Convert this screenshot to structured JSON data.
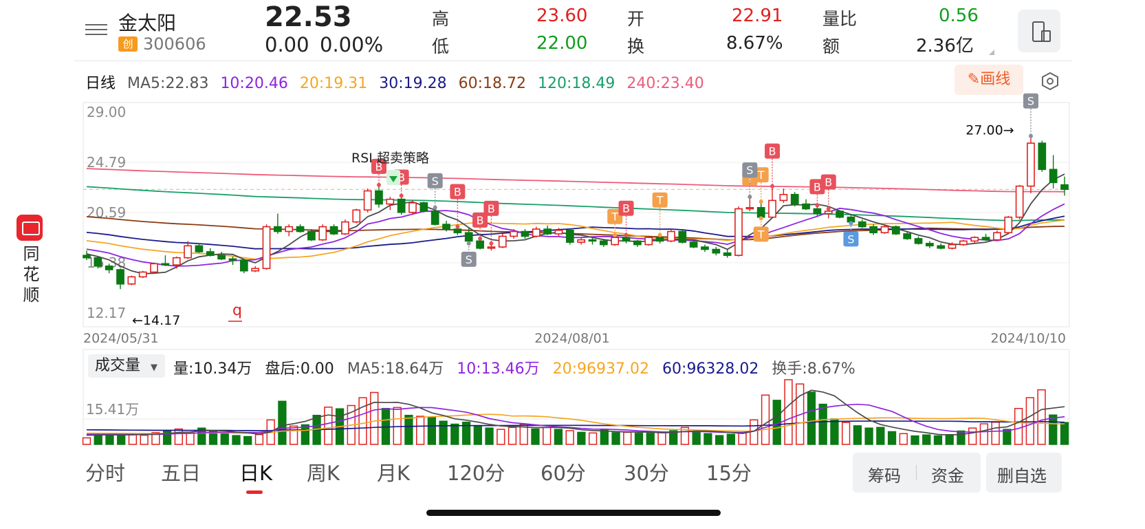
{
  "brand": {
    "name": "同花顺"
  },
  "stock": {
    "name": "金太阳",
    "board_badge": "创",
    "code": "300606",
    "price": "22.53",
    "change": "0.00",
    "change_pct": "0.00%"
  },
  "quote": {
    "high_label": "高",
    "high_value": "23.60",
    "low_label": "低",
    "low_value": "22.00",
    "open_label": "开",
    "open_value": "22.91",
    "turnover_label": "换",
    "turnover_value": "8.67%",
    "vol_ratio_label": "量比",
    "vol_ratio_value": "0.56",
    "amount_label": "额",
    "amount_value": "2.36亿"
  },
  "ma_legend": {
    "period": "日线",
    "ma5": "MA5:22.83",
    "ma10": "10:20.46",
    "ma20": "20:19.31",
    "ma30": "30:19.28",
    "ma60": "60:18.72",
    "ma120": "120:18.49",
    "ma240": "240:23.40"
  },
  "draw_button": "画线",
  "colors": {
    "up": "#e0201e",
    "down": "#0b7a14",
    "ma5": "#4a4a4a",
    "ma10": "#8e24e0",
    "ma20": "#f5a623",
    "ma30": "#1a1a8c",
    "ma60": "#8b3a12",
    "ma120": "#16a068",
    "ma240": "#ec5c7a"
  },
  "kline_axis": {
    "y_labels": [
      "29.00",
      "24.79",
      "20.59",
      "16.38",
      "12.17"
    ],
    "x_labels": [
      "2024/05/31",
      "2024/08/01",
      "2024/10/10"
    ],
    "max_marker": "27.00→",
    "min_marker": "←14.17",
    "strategy_label": "RSI 超卖策略",
    "q_marker": "q"
  },
  "signals": [
    {
      "t": "B"
    },
    {
      "t": "S"
    },
    {
      "t": "B"
    },
    {
      "t": "B"
    },
    {
      "t": "S"
    },
    {
      "t": "B"
    },
    {
      "t": "T"
    },
    {
      "t": "B"
    },
    {
      "t": "T"
    },
    {
      "t": "T"
    },
    {
      "t": "T"
    },
    {
      "t": "B"
    },
    {
      "t": "B"
    },
    {
      "t": "B"
    },
    {
      "t": "S"
    },
    {
      "t": "T"
    },
    {
      "t": "S"
    },
    {
      "t": "S"
    },
    {
      "t": "B"
    }
  ],
  "volume": {
    "selector": "成交量",
    "vol": "量:10.34万",
    "after_hours": "盘后:0.00",
    "ma5": "MA5:18.64万",
    "ma10": "10:13.46万",
    "ma20": "20:96937.02",
    "ma60": "60:96328.02",
    "turnover": "换手:8.67%",
    "y_label": "15.41万"
  },
  "chart_data": [
    {
      "type": "candlestick",
      "title": "日线",
      "x_start": "2024/05/31",
      "x_mid": "2024/08/01",
      "x_end": "2024/10/10",
      "ylim": [
        12.17,
        29.0
      ],
      "candles_ohlc": [
        [
          17.0,
          17.4,
          16.6,
          16.8
        ],
        [
          16.8,
          16.9,
          15.9,
          16.1
        ],
        [
          16.1,
          16.3,
          15.5,
          15.8
        ],
        [
          15.8,
          15.9,
          14.17,
          14.6
        ],
        [
          14.6,
          15.3,
          14.5,
          15.2
        ],
        [
          15.2,
          15.7,
          15.1,
          15.6
        ],
        [
          15.6,
          16.4,
          15.5,
          16.3
        ],
        [
          16.3,
          17.0,
          16.1,
          16.2
        ],
        [
          16.2,
          16.9,
          15.9,
          16.8
        ],
        [
          16.8,
          18.2,
          16.7,
          17.8
        ],
        [
          17.8,
          18.0,
          17.2,
          17.3
        ],
        [
          17.3,
          17.6,
          16.9,
          17.0
        ],
        [
          17.0,
          17.3,
          16.6,
          16.7
        ],
        [
          16.7,
          16.9,
          16.2,
          16.6
        ],
        [
          16.6,
          16.7,
          15.5,
          15.7
        ],
        [
          15.7,
          16.1,
          15.6,
          15.9
        ],
        [
          15.9,
          19.6,
          15.8,
          19.4
        ],
        [
          19.4,
          20.5,
          18.8,
          19.0
        ],
        [
          19.0,
          19.6,
          18.6,
          19.4
        ],
        [
          19.4,
          19.6,
          18.9,
          19.0
        ],
        [
          19.0,
          19.2,
          18.2,
          18.3
        ],
        [
          18.3,
          19.6,
          18.2,
          19.4
        ],
        [
          19.4,
          19.6,
          18.7,
          18.8
        ],
        [
          18.8,
          20.0,
          18.7,
          19.8
        ],
        [
          19.8,
          20.9,
          19.7,
          20.8
        ],
        [
          20.8,
          22.6,
          20.6,
          22.4
        ],
        [
          22.4,
          22.9,
          21.0,
          21.3
        ],
        [
          21.3,
          21.9,
          20.8,
          21.7
        ],
        [
          21.7,
          22.0,
          20.4,
          20.6
        ],
        [
          20.6,
          21.6,
          20.4,
          21.4
        ],
        [
          21.4,
          21.5,
          20.6,
          20.7
        ],
        [
          20.7,
          21.0,
          19.5,
          19.6
        ],
        [
          19.6,
          19.9,
          19.0,
          19.2
        ],
        [
          19.2,
          19.4,
          18.7,
          18.9
        ],
        [
          18.9,
          19.3,
          18.0,
          18.2
        ],
        [
          18.2,
          18.4,
          17.5,
          17.6
        ],
        [
          17.6,
          18.0,
          17.4,
          17.7
        ],
        [
          17.7,
          18.8,
          17.6,
          18.6
        ],
        [
          18.6,
          19.2,
          18.4,
          19.0
        ],
        [
          19.0,
          19.2,
          18.4,
          18.6
        ],
        [
          18.6,
          19.4,
          18.5,
          19.2
        ],
        [
          19.2,
          19.5,
          18.7,
          18.8
        ],
        [
          18.8,
          19.3,
          18.6,
          19.1
        ],
        [
          19.1,
          19.2,
          17.9,
          18.1
        ],
        [
          18.1,
          18.5,
          17.9,
          18.3
        ],
        [
          18.3,
          18.5,
          17.9,
          18.2
        ],
        [
          18.2,
          18.3,
          17.7,
          17.9
        ],
        [
          17.9,
          18.7,
          17.8,
          18.5
        ],
        [
          18.5,
          18.7,
          18.0,
          18.2
        ],
        [
          18.2,
          18.3,
          17.7,
          17.9
        ],
        [
          17.9,
          18.6,
          17.8,
          18.5
        ],
        [
          18.5,
          18.7,
          18.0,
          18.2
        ],
        [
          18.2,
          19.2,
          18.1,
          19.0
        ],
        [
          19.0,
          19.1,
          18.0,
          18.1
        ],
        [
          18.1,
          18.3,
          17.6,
          17.7
        ],
        [
          17.7,
          17.9,
          17.3,
          17.5
        ],
        [
          17.5,
          17.7,
          17.0,
          17.2
        ],
        [
          17.2,
          17.5,
          16.8,
          17.0
        ],
        [
          17.0,
          21.1,
          16.9,
          20.9
        ],
        [
          20.9,
          21.9,
          20.7,
          21.0
        ],
        [
          21.0,
          21.5,
          20.1,
          20.2
        ],
        [
          20.2,
          22.8,
          20.1,
          21.6
        ],
        [
          21.6,
          22.6,
          21.4,
          22.1
        ],
        [
          22.1,
          22.3,
          21.1,
          21.3
        ],
        [
          21.3,
          21.7,
          20.8,
          20.9
        ],
        [
          20.9,
          21.2,
          20.3,
          20.5
        ],
        [
          20.5,
          20.9,
          20.1,
          20.7
        ],
        [
          20.7,
          20.8,
          20.1,
          20.2
        ],
        [
          20.2,
          20.4,
          19.7,
          19.8
        ],
        [
          19.8,
          20.0,
          19.3,
          19.4
        ],
        [
          19.4,
          19.6,
          18.7,
          18.9
        ],
        [
          18.9,
          19.5,
          18.8,
          19.4
        ],
        [
          19.4,
          19.5,
          18.7,
          18.8
        ],
        [
          18.8,
          19.0,
          18.3,
          18.4
        ],
        [
          18.4,
          18.6,
          17.9,
          18.0
        ],
        [
          18.0,
          18.2,
          17.6,
          17.8
        ],
        [
          17.8,
          18.0,
          17.5,
          17.6
        ],
        [
          17.6,
          18.1,
          17.5,
          17.9
        ],
        [
          17.9,
          18.3,
          17.8,
          18.2
        ],
        [
          18.2,
          18.6,
          18.0,
          18.5
        ],
        [
          18.5,
          18.8,
          18.2,
          18.3
        ],
        [
          18.3,
          19.1,
          18.2,
          18.9
        ],
        [
          18.9,
          20.3,
          18.8,
          20.2
        ],
        [
          20.2,
          22.9,
          20.0,
          22.8
        ],
        [
          22.8,
          27.0,
          22.2,
          26.4
        ],
        [
          26.4,
          26.6,
          24.0,
          24.2
        ],
        [
          24.2,
          25.4,
          22.6,
          23.1
        ],
        [
          22.91,
          23.6,
          22.0,
          22.53
        ]
      ]
    },
    {
      "type": "bar",
      "title": "成交量",
      "ylabel_tick": "15.41万",
      "values": [
        2.0,
        3.4,
        3.1,
        3.0,
        3.1,
        2.8,
        3.6,
        4.1,
        4.7,
        3.5,
        5.0,
        4.0,
        3.6,
        2.7,
        2.4,
        3.0,
        7.5,
        13.2,
        5.6,
        6.0,
        8.9,
        11.4,
        10.9,
        11.9,
        14.3,
        15.9,
        11.0,
        11.3,
        8.9,
        8.6,
        8.4,
        7.1,
        6.2,
        6.8,
        5.6,
        5.0,
        4.6,
        5.2,
        6.2,
        4.7,
        5.2,
        4.6,
        4.2,
        3.7,
        3.5,
        4.6,
        3.6,
        3.7,
        3.4,
        3.4,
        3.6,
        4.2,
        5.2,
        4.0,
        3.3,
        2.7,
        3.1,
        3.6,
        7.5,
        15.1,
        13.5,
        19.8,
        18.5,
        16.0,
        12.3,
        7.8,
        6.7,
        5.7,
        5.0,
        5.2,
        3.9,
        3.3,
        2.6,
        2.9,
        2.6,
        3.0,
        4.1,
        5.0,
        6.3,
        6.8,
        4.6,
        11.0,
        14.3,
        16.7,
        9.0,
        6.7
      ],
      "up_flags": [
        1,
        0,
        0,
        0,
        1,
        1,
        1,
        0,
        1,
        1,
        0,
        0,
        0,
        0,
        0,
        1,
        1,
        0,
        1,
        0,
        0,
        1,
        0,
        1,
        1,
        1,
        0,
        1,
        0,
        1,
        0,
        0,
        0,
        0,
        0,
        0,
        1,
        1,
        1,
        0,
        1,
        0,
        1,
        0,
        1,
        0,
        0,
        1,
        0,
        0,
        1,
        0,
        1,
        0,
        0,
        0,
        0,
        1,
        1,
        1,
        0,
        1,
        1,
        0,
        0,
        0,
        1,
        0,
        0,
        0,
        0,
        1,
        0,
        0,
        0,
        0,
        0,
        1,
        1,
        1,
        0,
        1,
        1,
        1,
        0,
        0
      ]
    }
  ],
  "tabs": [
    "分时",
    "五日",
    "日K",
    "周K",
    "月K",
    "120分",
    "60分",
    "30分",
    "15分"
  ],
  "active_tab": "日K",
  "bottom_buttons": {
    "chips": "筹码",
    "funds": "资金",
    "remove": "删自选"
  }
}
